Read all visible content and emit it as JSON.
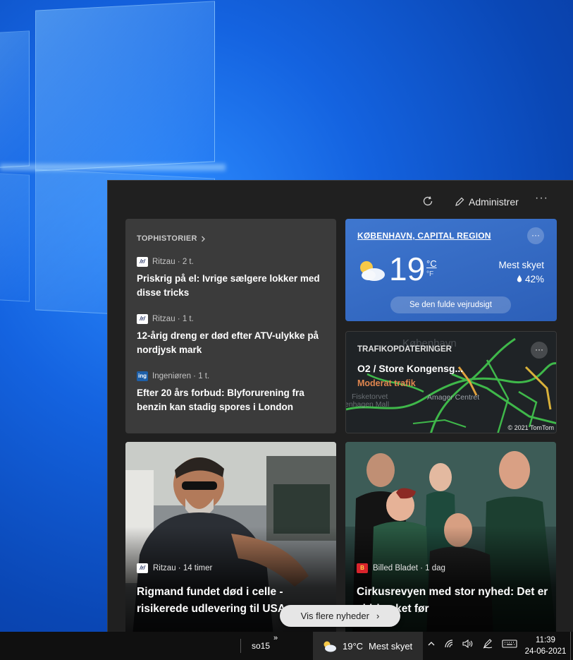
{
  "header": {
    "manage_label": "Administrer",
    "more_label": "···"
  },
  "top_stories": {
    "heading": "TOPHISTORIER",
    "items": [
      {
        "source": "Ritzau · 2 t.",
        "logo": "ritzau",
        "title": "Priskrig på el: Ivrige sælgere lokker med disse tricks"
      },
      {
        "source": "Ritzau · 1 t.",
        "logo": "ritzau",
        "title": "12-årig dreng er død efter ATV-ulykke på nordjysk mark"
      },
      {
        "source": "Ingeniøren · 1 t.",
        "logo": "ing",
        "title": "Efter 20 års forbud: Blyforurening fra benzin kan stadig spores i London"
      }
    ]
  },
  "weather": {
    "location": "KØBENHAVN, CAPITAL REGION",
    "temp": "19",
    "unit_c": "°C",
    "unit_f": "°F",
    "condition": "Mest skyet",
    "rain": "42%",
    "button": "Se den fulde vejrudsigt",
    "more": "···"
  },
  "traffic": {
    "heading": "TRAFIKOPDATERINGER",
    "route": "O2 / Store Kongensg...",
    "status": "Moderat trafik",
    "map_labels": [
      "København",
      "Amager Centret",
      "Fisketorvet",
      "enhagen Mall"
    ],
    "copyright": "© 2021 TomTom",
    "more": "···"
  },
  "cards": [
    {
      "source": "Ritzau · 14 timer",
      "title": "Rigmand fundet død i celle - risikerede udlevering til USA"
    },
    {
      "source": "Billed Bladet · 1 dag",
      "title": "Cirkusrevyen med stor nyhed: Det er aldrig sket før"
    }
  ],
  "more_news": {
    "label": "Vis flere nyheder",
    "chevron": "›"
  },
  "taskbar": {
    "user": "so15",
    "chevron": "»",
    "weather_temp": "19°C",
    "weather_text": "Mest skyet",
    "time": "11:39",
    "date": "24-06-2021"
  },
  "colors": {
    "panel_bg": "#202020",
    "weather_bg": "#3f77cf",
    "traffic_moderate": "#e0864f",
    "road_green": "#3fb84a"
  }
}
